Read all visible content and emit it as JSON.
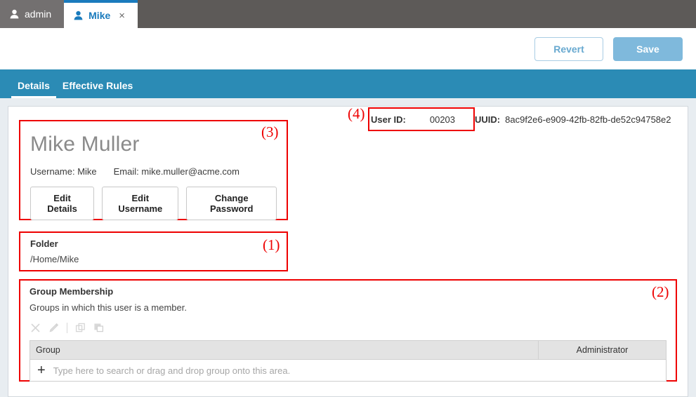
{
  "window_tabs": [
    {
      "label": "admin",
      "icon": "user-icon",
      "active": false,
      "closable": false
    },
    {
      "label": "Mike",
      "icon": "user-icon",
      "active": true,
      "closable": true,
      "close_glyph": "×"
    }
  ],
  "actionbar": {
    "revert_label": "Revert",
    "save_label": "Save"
  },
  "subtabs": [
    {
      "label": "Details",
      "active": true
    },
    {
      "label": "Effective Rules",
      "active": false
    }
  ],
  "identity": {
    "user_id_label": "User ID:",
    "user_id_value": "00203",
    "uuid_label": "UUID:",
    "uuid_value": "8ac9f2e6-e909-42fb-82fb-de52c94758e2"
  },
  "profile": {
    "display_name": "Mike Muller",
    "username_text": "Username: Mike",
    "email_text": "Email: mike.muller@acme.com",
    "buttons": [
      "Edit Details",
      "Edit Username",
      "Change Password"
    ]
  },
  "folder": {
    "title": "Folder",
    "path": "/Home/Mike"
  },
  "group_membership": {
    "title": "Group Membership",
    "description": "Groups in which this user is a member.",
    "toolbar_icons": [
      "delete-icon",
      "edit-icon",
      "copy-icon",
      "paste-icon"
    ],
    "columns": [
      "Group",
      "Administrator"
    ],
    "rows": [],
    "search_placeholder": "Type here to search or drag and drop group onto this area.",
    "add_glyph": "+"
  },
  "annotations": [
    {
      "id": "1",
      "label": "(1)"
    },
    {
      "id": "2",
      "label": "(2)"
    },
    {
      "id": "3",
      "label": "(3)"
    },
    {
      "id": "4",
      "label": "(4)"
    }
  ],
  "colors": {
    "tabstrip_bg": "#5d5a58",
    "accent_teal": "#2b8bb5",
    "accent_blue": "#1a7bbd",
    "save_disabled": "#7fb9dc",
    "annotation_red": "#ee0000",
    "page_bg": "#e8edf1"
  }
}
